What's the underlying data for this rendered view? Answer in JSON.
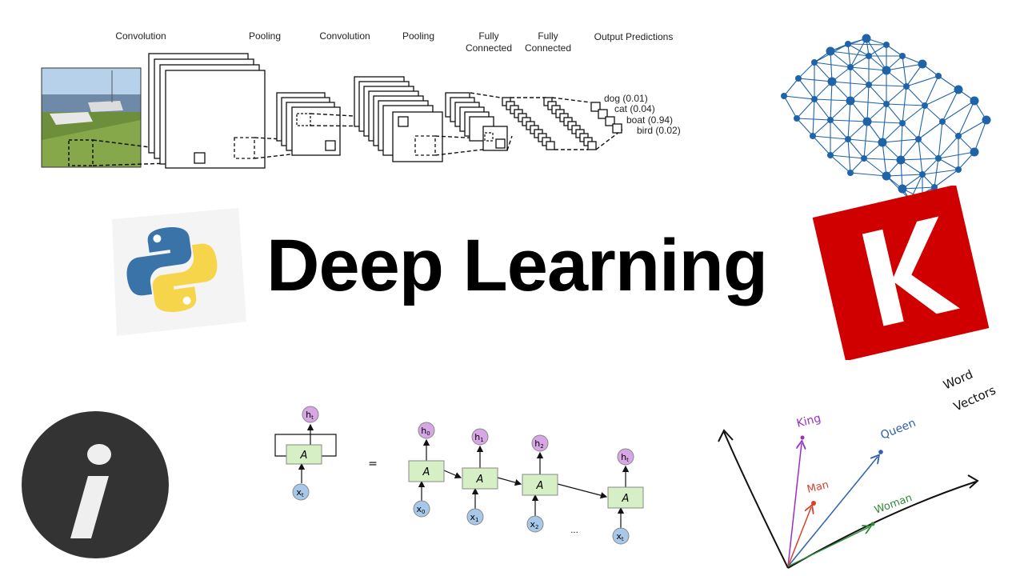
{
  "title": "Deep Learning",
  "cnn": {
    "stages": [
      "Convolution",
      "Pooling",
      "Convolution",
      "Pooling",
      "Fully\nConnected",
      "Fully\nConnected",
      "Output Predictions"
    ],
    "predictions": [
      "dog (0.01)",
      "cat (0.04)",
      "boat (0.94)",
      "bird (0.02)"
    ]
  },
  "rnn": {
    "cell": "A",
    "hidden_t": "h",
    "hidden_t_sub": "t",
    "input_t": "x",
    "input_t_sub": "t",
    "equals": "=",
    "unrolled": [
      {
        "h": "h",
        "h_sub": "0",
        "x": "x",
        "x_sub": "0"
      },
      {
        "h": "h",
        "h_sub": "1",
        "x": "x",
        "x_sub": "1"
      },
      {
        "h": "h",
        "h_sub": "2",
        "x": "x",
        "x_sub": "2"
      },
      {
        "h": "h",
        "h_sub": "t",
        "x": "x",
        "x_sub": "t"
      }
    ],
    "ellipsis": "..."
  },
  "word_vectors": {
    "heading_line1": "Word",
    "heading_line2": "Vectors",
    "words": [
      {
        "label": "King",
        "color": "#9b2fc4"
      },
      {
        "label": "Queen",
        "color": "#2f5fb0"
      },
      {
        "label": "Man",
        "color": "#d8402d"
      },
      {
        "label": "Woman",
        "color": "#2e8b3a"
      }
    ]
  },
  "colors": {
    "python_blue": "#3a73a8",
    "python_yellow": "#f7d54a",
    "keras_red": "#d00000",
    "brain_blue": "#1f63a8",
    "rnn_cell_fill": "#d6efc4",
    "rnn_hidden_fill": "#d7a6e4",
    "rnn_input_fill": "#a8c8ea",
    "jupyter_dark": "#333333"
  },
  "icons": [
    "python-logo-icon",
    "keras-logo-icon",
    "brain-network-icon",
    "jupyter-semicolon-icon"
  ]
}
